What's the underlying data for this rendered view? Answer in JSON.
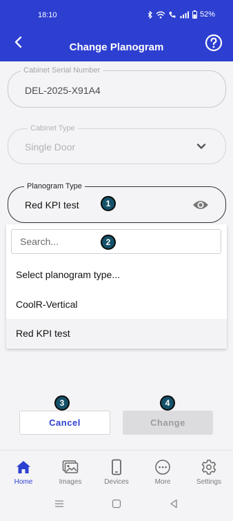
{
  "status_bar": {
    "time": "18:10",
    "battery": "52%"
  },
  "header": {
    "title": "Change Planogram",
    "back_icon": "chevron-left-icon",
    "help_icon": "help-circle-icon"
  },
  "form": {
    "serial": {
      "label": "Cabinet Serial Number",
      "value": "DEL-2025-X91A4"
    },
    "cabinet_type": {
      "label": "Cabinet Type",
      "value": "Single Door"
    },
    "planogram_type": {
      "label": "Planogram Type",
      "value": "Red KPI test"
    }
  },
  "dropdown": {
    "search_placeholder": "Search...",
    "options": [
      "Select planogram type...",
      "CoolR-Vertical",
      "Red KPI test"
    ],
    "selected": "Red KPI test"
  },
  "badges": [
    "1",
    "2",
    "3",
    "4"
  ],
  "actions": {
    "cancel": "Cancel",
    "change": "Change"
  },
  "nav": [
    {
      "label": "Home",
      "icon": "home-icon"
    },
    {
      "label": "Images",
      "icon": "images-icon"
    },
    {
      "label": "Devices",
      "icon": "phone-icon"
    },
    {
      "label": "More",
      "icon": "more-icon"
    },
    {
      "label": "Settings",
      "icon": "gear-icon"
    }
  ],
  "colors": {
    "primary": "#2d3fd0",
    "badge": "#155269",
    "background": "#f4f4f6"
  }
}
